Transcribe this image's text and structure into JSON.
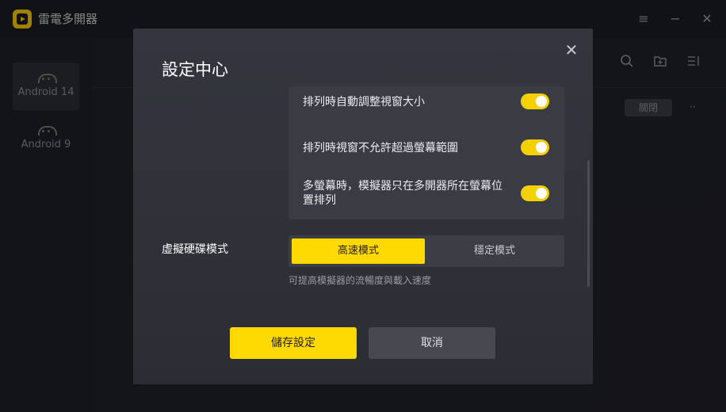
{
  "app": {
    "title": "雷電多開器",
    "icon": "app-logo",
    "window_controls": [
      "menu-icon",
      "minimize-icon",
      "close-icon"
    ]
  },
  "sidebar": {
    "items": [
      {
        "label": "Android 14",
        "icon": "android-icon",
        "active": true
      },
      {
        "label": "Android 9",
        "icon": "android-icon",
        "active": false
      }
    ]
  },
  "toolbar": {
    "icons": [
      "search-icon",
      "add-folder-icon",
      "sort-icon"
    ],
    "close_label": "關閉",
    "more_label": "··"
  },
  "dialog": {
    "title": "設定中心",
    "close_icon": "close-icon",
    "options": [
      {
        "label": "排列時自動調整視窗大小",
        "enabled": true
      },
      {
        "label": "排列時視窗不允許超過螢幕範圍",
        "enabled": true
      },
      {
        "label": "多螢幕時，模擬器只在多開器所在螢幕位置排列",
        "enabled": true
      }
    ],
    "disk_mode": {
      "label": "虛擬硬碟模式",
      "options": [
        "高速模式",
        "穩定模式"
      ],
      "selected": "高速模式",
      "hint": "可提高模擬器的流暢度與載入速度"
    },
    "save_label": "儲存設定",
    "cancel_label": "取消"
  },
  "colors": {
    "accent": "#ffd900",
    "dialog_bg": "#30313a",
    "panel_bg": "#3a3b43"
  }
}
